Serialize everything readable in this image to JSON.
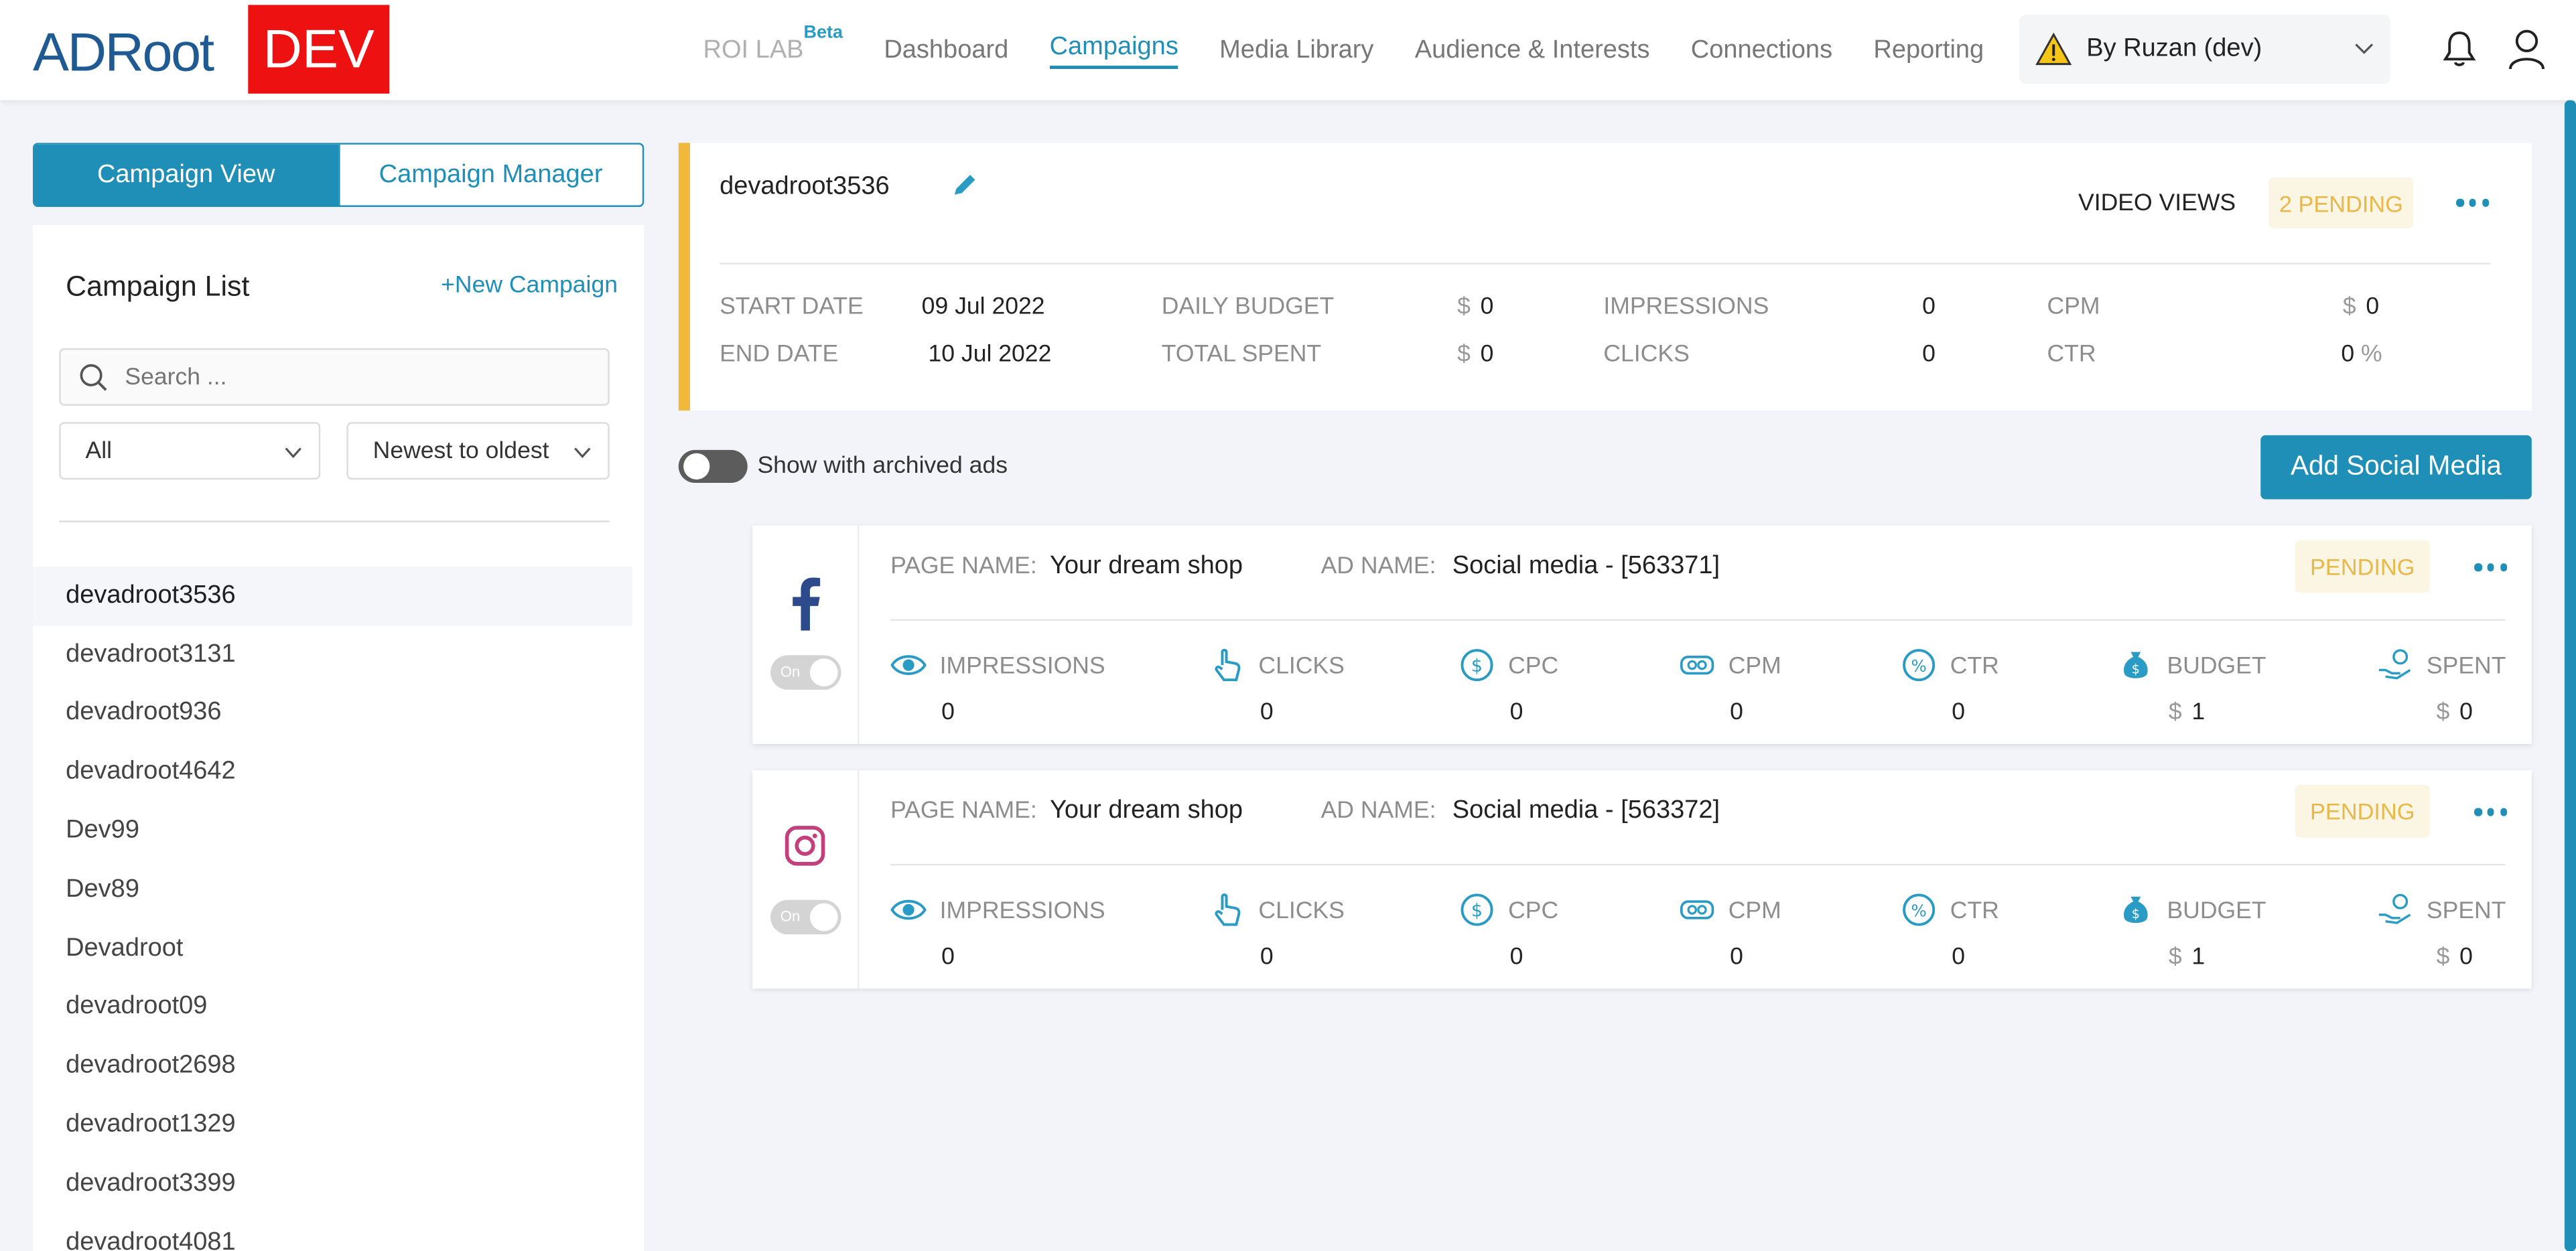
{
  "header": {
    "logo_prefix": "ADRoot",
    "env_badge": "DEV",
    "nav": [
      {
        "label": "ROI LAB",
        "sup": "Beta"
      },
      {
        "label": "Dashboard"
      },
      {
        "label": "Campaigns"
      },
      {
        "label": "Media Library"
      },
      {
        "label": "Audience & Interests"
      },
      {
        "label": "Connections"
      },
      {
        "label": "Reporting"
      }
    ],
    "account": "By Ruzan (dev)",
    "icons": [
      "warning-icon",
      "chevron-down-icon",
      "bell-icon",
      "user-icon"
    ]
  },
  "sidebar": {
    "tabs": [
      "Campaign View",
      "Campaign Manager"
    ],
    "title": "Campaign List",
    "new_campaign": "+New Campaign",
    "search_placeholder": "Search ...",
    "filter": "All",
    "sort": "Newest to oldest",
    "campaigns": [
      "devadroot3536",
      "devadroot3131",
      "devadroot936",
      "devadroot4642",
      "Dev99",
      "Dev89",
      "Devadroot",
      "devadroot09",
      "devadroot2698",
      "devadroot1329",
      "devadroot3399",
      "devadroot4081"
    ]
  },
  "summary": {
    "name": "devadroot3536",
    "objective": "VIDEO VIEWS",
    "status": "2 PENDING",
    "start_label": "START DATE",
    "start": "09 Jul 2022",
    "end_label": "END DATE",
    "end": "10 Jul 2022",
    "daily_budget_label": "DAILY BUDGET",
    "daily_budget": "0",
    "total_spent_label": "TOTAL SPENT",
    "total_spent": "0",
    "impressions_label": "IMPRESSIONS",
    "impressions": "0",
    "clicks_label": "CLICKS",
    "clicks": "0",
    "cpm_label": "CPM",
    "cpm": "0",
    "ctr_label": "CTR",
    "ctr": "0",
    "currency": "$",
    "percent": "%"
  },
  "archived_label": "Show with archived ads",
  "add_social": "Add Social Media",
  "ads": [
    {
      "platform": "facebook",
      "page_name_label": "PAGE NAME:",
      "page_name": "Your dream shop",
      "ad_name_label": "AD NAME:",
      "ad_name": "Social media - [563371]",
      "status": "PENDING",
      "switch": "On",
      "metrics": {
        "impressions": "0",
        "clicks": "0",
        "cpc": "0",
        "cpm": "0",
        "ctr": "0",
        "budget": "1",
        "spent": "0"
      }
    },
    {
      "platform": "instagram",
      "page_name_label": "PAGE NAME:",
      "page_name": "Your dream shop",
      "ad_name_label": "AD NAME:",
      "ad_name": "Social media - [563372]",
      "status": "PENDING",
      "switch": "On",
      "metrics": {
        "impressions": "0",
        "clicks": "0",
        "cpc": "0",
        "cpm": "0",
        "ctr": "0",
        "budget": "1",
        "spent": "0"
      }
    }
  ],
  "metric_labels": [
    "IMPRESSIONS",
    "CLICKS",
    "CPC",
    "CPM",
    "CTR",
    "BUDGET",
    "SPENT"
  ],
  "colors": {
    "accent": "#1f8fb8",
    "pending": "#e7b84a",
    "dev_badge": "#ee1111",
    "summary_border": "#f0b93b"
  }
}
